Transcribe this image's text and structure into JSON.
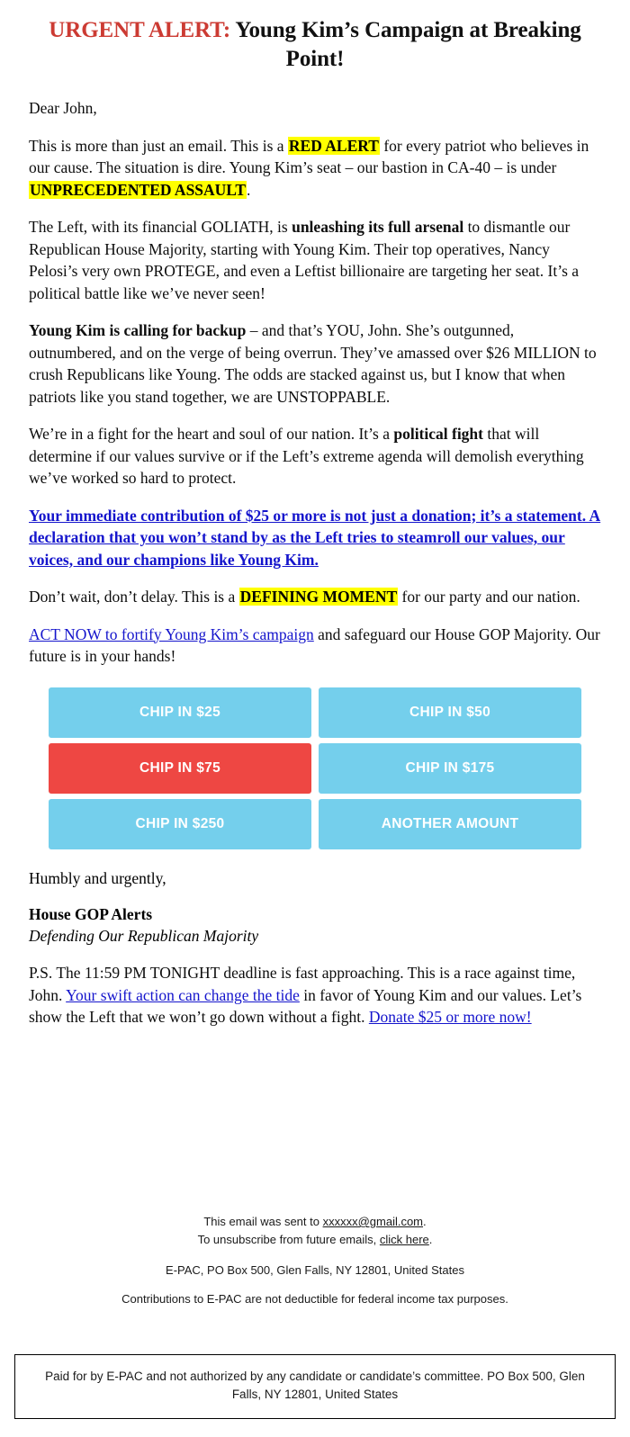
{
  "header": {
    "urgent_prefix": "URGENT ALERT:",
    "headline_rest": " Young Kim’s Campaign at Breaking Point!",
    "urgent_color": "#cc3b33"
  },
  "body": {
    "salutation": "Dear John,",
    "p1_a": "This is more than just an email. This is a ",
    "p1_hl1": "RED ALERT",
    "p1_b": " for every patriot who believes in our cause. The situation is dire. Young Kim’s seat – our bastion in CA-40 – is under ",
    "p1_hl2": "UNPRECEDENTED ASSAULT",
    "p1_c": ".",
    "p2_a": "The Left, with its financial GOLIATH, is ",
    "p2_bold": "unleashing its full arsenal",
    "p2_b": " to dismantle our Republican House Majority, starting with Young Kim. Their top operatives, Nancy Pelosi’s very own PROTEGE, and even a Leftist billionaire are targeting her seat. It’s a political battle like we’ve never seen!",
    "p3_bold": "Young Kim is calling for backup",
    "p3_rest": " – and that’s YOU, John. She’s outgunned, outnumbered, and on the verge of being overrun. They’ve amassed over $26 MILLION to crush Republicans like Young. The odds are stacked against us, but I know that when patriots like you stand together, we are UNSTOPPABLE.",
    "p4_a": "We’re in a fight for the heart and soul of our nation. It’s a ",
    "p4_bold": "political fight",
    "p4_b": " that will determine if our values survive or if the Left’s extreme agenda will demolish everything we’ve worked so hard to protect.",
    "p5_link": "Your immediate contribution of $25 or more is not just a donation; it’s a statement. A declaration that you won’t stand by as the Left tries to steamroll our values, our voices, and our champions like Young Kim.",
    "p6_a": "Don’t wait, don’t delay. This is a ",
    "p6_hl": "DEFINING MOMENT",
    "p6_b": " for our party and our nation.",
    "p7_link": "ACT NOW to fortify Young Kim’s campaign",
    "p7_rest": " and safeguard our House GOP Majority. Our future is in your hands!"
  },
  "donate": {
    "buttons": [
      {
        "label": "CHIP IN $25",
        "style": "blue"
      },
      {
        "label": "CHIP IN $50",
        "style": "blue"
      },
      {
        "label": "CHIP IN $75",
        "style": "red"
      },
      {
        "label": "CHIP IN $175",
        "style": "blue"
      },
      {
        "label": "CHIP IN $250",
        "style": "blue"
      },
      {
        "label": "ANOTHER AMOUNT",
        "style": "blue"
      }
    ],
    "blue_color": "#74cfec",
    "red_color": "#ee4743"
  },
  "signature": {
    "closing": "Humbly and urgently,",
    "name": "House GOP Alerts",
    "tagline": "Defending Our Republican Majority"
  },
  "postscript": {
    "a": "P.S. The 11:59 PM TONIGHT deadline is fast approaching. This is a race against time, John. ",
    "link1": "Your swift action can change the tide",
    "b": " in favor of Young Kim and our values. Let’s show the Left that we won’t go down without a fight. ",
    "link2": "Donate $25 or more now!"
  },
  "footer": {
    "sent_prefix": "This email was sent to ",
    "sent_email": "xxxxxx@gmail.com",
    "sent_suffix": ".",
    "unsub_prefix": "To unsubscribe from future emails, ",
    "unsub_link": "click here",
    "unsub_suffix": ".",
    "address": "E-PAC, PO Box 500, Glen Falls, NY 12801, United States",
    "tax_note": "Contributions to E-PAC are not deductible for federal income tax purposes.",
    "disclaimer": "Paid for by E-PAC and not authorized by any candidate or candidate’s committee. PO Box 500, Glen Falls, NY 12801, United States"
  }
}
